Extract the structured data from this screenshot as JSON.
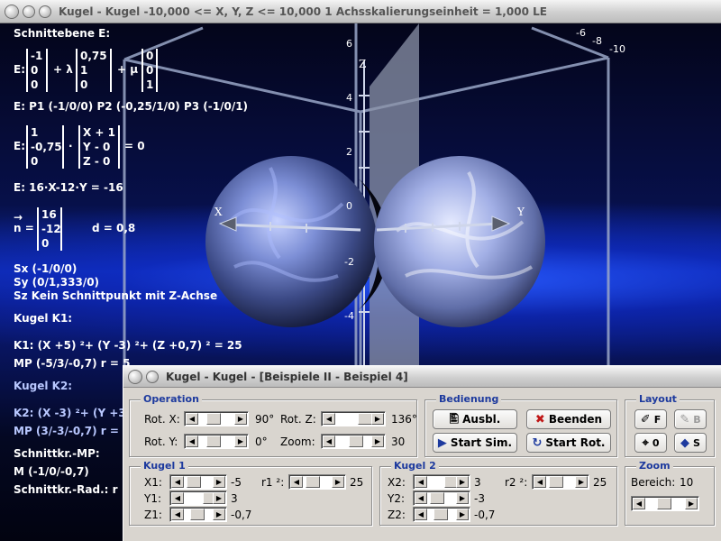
{
  "main_window": {
    "title": "Kugel - Kugel   -10,000 <= X, Y, Z <= 10,000    1 Achsskalierungseinheit = 1,000 LE"
  },
  "scene": {
    "schnittebene_label": "Schnittebene E:",
    "e_prefix": "E:",
    "vec1": [
      "-1",
      "0",
      "0"
    ],
    "plus_lambda": "+ λ",
    "vec2": [
      "0,75",
      "1",
      "0"
    ],
    "plus_mu": "+ μ",
    "vec3": [
      "0",
      "0",
      "1"
    ],
    "points_line": "E:  P1 (-1/0/0)    P2 (-0,25/1/0)    P3 (-1/0/1)",
    "e2_prefix": "E:",
    "normal_vec": [
      "1",
      "-0,75",
      "0"
    ],
    "dot": "·",
    "x_minus": [
      "X + 1",
      "Y - 0",
      "Z - 0"
    ],
    "equals_zero": "= 0",
    "coord_eq": "E: 16·X-12·Y = -16",
    "n_arrow": "→",
    "n_label": "n =",
    "n_vec": [
      "16",
      "-12",
      "0"
    ],
    "d_label": "d = 0,8",
    "sx": "Sx (-1/0/0)",
    "sy": "Sy (0/1,333/0)",
    "sz": "Sz Kein Schnittpunkt mit Z-Achse",
    "kugel_k1": "Kugel K1:",
    "k1_eq": "K1: (X +5) ²+ (Y -3) ²+ (Z +0,7) ² = 25",
    "k1_mp": "MP (-5/3/-0,7)   r = 5",
    "kugel_k2": "Kugel K2:",
    "k2_eq": "K2: (X -3) ²+ (Y +3",
    "k2_mp": "MP (3/-3/-0,7)   r =",
    "schnittkr_mp": "Schnittkr.-MP:",
    "m_point": "M (-1/0/-0,7)",
    "schnittkr_rad": "Schnittkr.-Rad.: r",
    "axis_z_ticks": [
      "6",
      "4",
      "2",
      "0",
      "-2",
      "-4"
    ],
    "axis_top_ticks": [
      "-6",
      "-8",
      "-10"
    ],
    "axis_labels": {
      "x": "X",
      "y": "Y",
      "z": "Z"
    }
  },
  "dialog": {
    "title": "Kugel - Kugel - [Beispiele II - Beispiel 4]",
    "operation": {
      "label": "Operation",
      "rot_x_label": "Rot. X:",
      "rot_x_value": "90°",
      "rot_y_label": "Rot. Y:",
      "rot_y_value": "0°",
      "rot_z_label": "Rot. Z:",
      "rot_z_value": "136°",
      "zoom_label": "Zoom:",
      "zoom_value": "30"
    },
    "bedienung": {
      "label": "Bedienung",
      "ausbl": "Ausbl.",
      "beenden": "Beenden",
      "start_sim": "Start Sim.",
      "start_rot": "Start Rot."
    },
    "layout": {
      "label": "Layout",
      "f": "F",
      "b": "B",
      "zero": "0",
      "s": "S"
    },
    "kugel1": {
      "label": "Kugel 1",
      "x1_label": "X1:",
      "x1_value": "-5",
      "y1_label": "Y1:",
      "y1_value": "3",
      "z1_label": "Z1:",
      "z1_value": "-0,7",
      "r1_label": "r1 ²:",
      "r1_value": "25"
    },
    "kugel2": {
      "label": "Kugel 2",
      "x2_label": "X2:",
      "x2_value": "3",
      "y2_label": "Y2:",
      "y2_value": "-3",
      "z2_label": "Z2:",
      "z2_value": "-0,7",
      "r2_label": "r2 ²:",
      "r2_value": "25"
    },
    "zoom_group": {
      "label": "Zoom",
      "bereich_label": "Bereich:",
      "bereich_value": "10"
    }
  }
}
